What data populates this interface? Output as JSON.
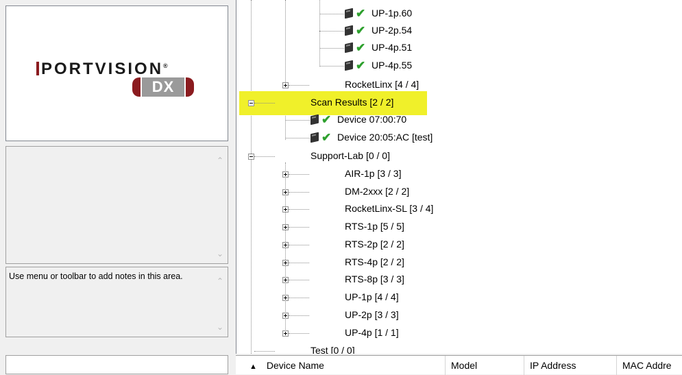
{
  "logo": {
    "brand": "PORTVISION",
    "registered": "®",
    "badge": "DX"
  },
  "notes": {
    "text": "Use menu or toolbar to add notes in this area."
  },
  "tree": {
    "nodes": [
      {
        "label": "UP-1p.60",
        "status": "check"
      },
      {
        "label": "UP-2p.54",
        "status": "check"
      },
      {
        "label": "UP-4p.51",
        "status": "check"
      },
      {
        "label": "UP-4p.55",
        "status": "check"
      },
      {
        "label": "RocketLinx [4 / 4]",
        "expander": "plus"
      },
      {
        "label": "Scan Results [2 / 2]",
        "expander": "minus",
        "highlighted": true
      },
      {
        "label": "Device 07:00:70",
        "status": "check"
      },
      {
        "label": "Device 20:05:AC [test]",
        "status": "check"
      },
      {
        "label": "Support-Lab [0 / 0]",
        "expander": "minus"
      },
      {
        "label": "AIR-1p [3 / 3]",
        "expander": "plus"
      },
      {
        "label": "DM-2xxx [2 / 2]",
        "expander": "plus"
      },
      {
        "label": "RocketLinx-SL [3 / 4]",
        "expander": "plus"
      },
      {
        "label": "RTS-1p [5 / 5]",
        "expander": "plus"
      },
      {
        "label": "RTS-2p [2 / 2]",
        "expander": "plus"
      },
      {
        "label": "RTS-4p [2 / 2]",
        "expander": "plus"
      },
      {
        "label": "RTS-8p [3 / 3]",
        "expander": "plus"
      },
      {
        "label": "UP-1p [4 / 4]",
        "expander": "plus"
      },
      {
        "label": "UP-2p [3 / 3]",
        "expander": "plus"
      },
      {
        "label": "UP-4p [1 / 1]",
        "expander": "plus"
      },
      {
        "label": "Test [0 / 0]"
      }
    ]
  },
  "columns": {
    "sort_indicator": "▲",
    "device_name": "Device Name",
    "model": "Model",
    "ip_address": "IP Address",
    "mac_address": "MAC Addre"
  },
  "colors": {
    "highlight": "#f0f02a",
    "check": "#2da02d",
    "brand": "#8b1b1f"
  }
}
